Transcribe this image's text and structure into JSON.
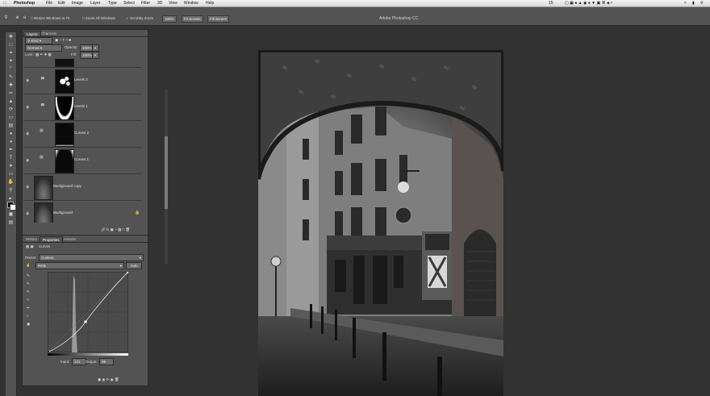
{
  "menubar": {
    "apple": "",
    "app_name": "Photoshop",
    "items": [
      "File",
      "Edit",
      "Image",
      "Layer",
      "Type",
      "Select",
      "Filter",
      "3D",
      "View",
      "Window",
      "Help"
    ],
    "status_count": "15"
  },
  "options_bar": {
    "resize_label": "Resize Windows to Fit",
    "zoom_all_label": "Zoom All Windows",
    "scrubby_label": "Scrubby Zoom",
    "btn_100": "100%",
    "btn_fit": "Fit Screen",
    "btn_fill": "Fill Screen",
    "app_title": "Adobe Photoshop CC"
  },
  "layers_panel": {
    "tabs": [
      "Layers",
      "Channels"
    ],
    "filter_kind": "Kind",
    "blend_mode": "Normal",
    "opacity_label": "Opacity:",
    "opacity_value": "100%",
    "lock_label": "Lock:",
    "fill_label": "Fill:",
    "fill_value": "100%",
    "layers": [
      {
        "name": "Levels 2",
        "kind": "adjustment"
      },
      {
        "name": "Levels 1",
        "kind": "adjustment"
      },
      {
        "name": "Curves 2",
        "kind": "adjustment"
      },
      {
        "name": "Curves 1",
        "kind": "adjustment"
      },
      {
        "name": "Background copy",
        "kind": "photo"
      },
      {
        "name": "Background",
        "kind": "photo"
      }
    ]
  },
  "properties_panel": {
    "tabs": [
      "History",
      "Properties",
      "Actions"
    ],
    "title": "Curves",
    "preset_label": "Preset:",
    "preset_value": "Custom",
    "channel_value": "RGB",
    "auto_label": "Auto",
    "input_label": "Input:",
    "input_value": "121",
    "output_label": "Output:",
    "output_value": "98"
  },
  "colors": {
    "ui_panel": "#535353",
    "workspace": "#323232",
    "menubar": "#e6e6e6"
  }
}
